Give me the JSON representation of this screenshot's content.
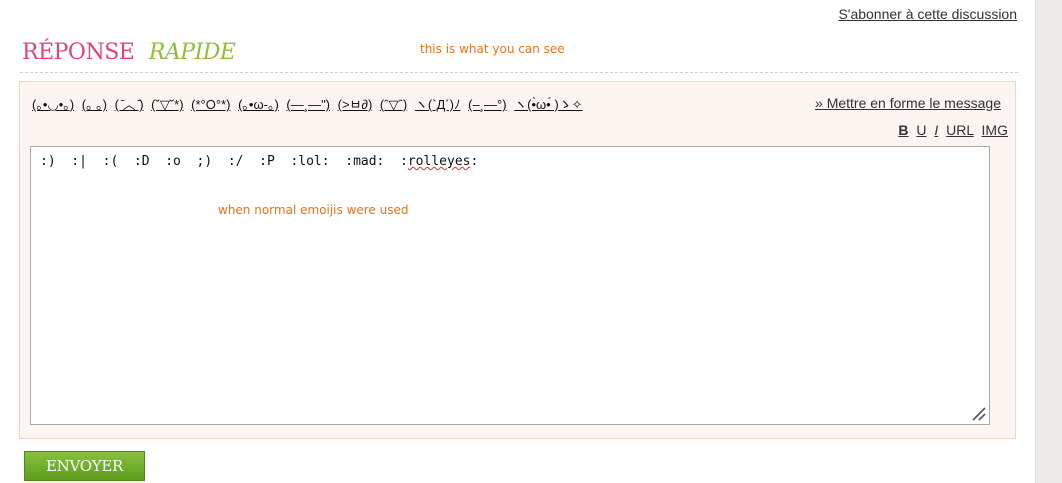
{
  "header": {
    "subscribe_link": "S'abonner à cette discussion"
  },
  "title": {
    "part1": "RÉPONSE",
    "part2": "RAPIDE"
  },
  "annotations": {
    "top": "this is what you can see",
    "middle": "when normal emoijis were used"
  },
  "smiley_bar": {
    "items": [
      "(｡•◡•｡)",
      "(｡ ｡)",
      "( ̄︿ ̄)",
      "(˘▽˘*)",
      "(*°O°*)",
      "(｡•ω-｡)",
      "(—¸—\")",
      "(>ㅂ∂)",
      "(ˆ▽ˆ)",
      "ヽ(`Д´)ﾉ",
      "(–¸—°)",
      "ヽ(•̀ω•́ )ゝ✧"
    ]
  },
  "formatting": {
    "format_link": "» Mettre en forme le message",
    "bold": "B",
    "underline": "U",
    "italic": "I",
    "url": "URL",
    "img": "IMG"
  },
  "editor": {
    "content_before": ":)  :|  :(  :D  :o  ;)  :/  :P  :lol:  :mad:  :",
    "content_spell": "rolleyes",
    "content_after": ":"
  },
  "actions": {
    "send_label": "ENVOYER"
  }
}
